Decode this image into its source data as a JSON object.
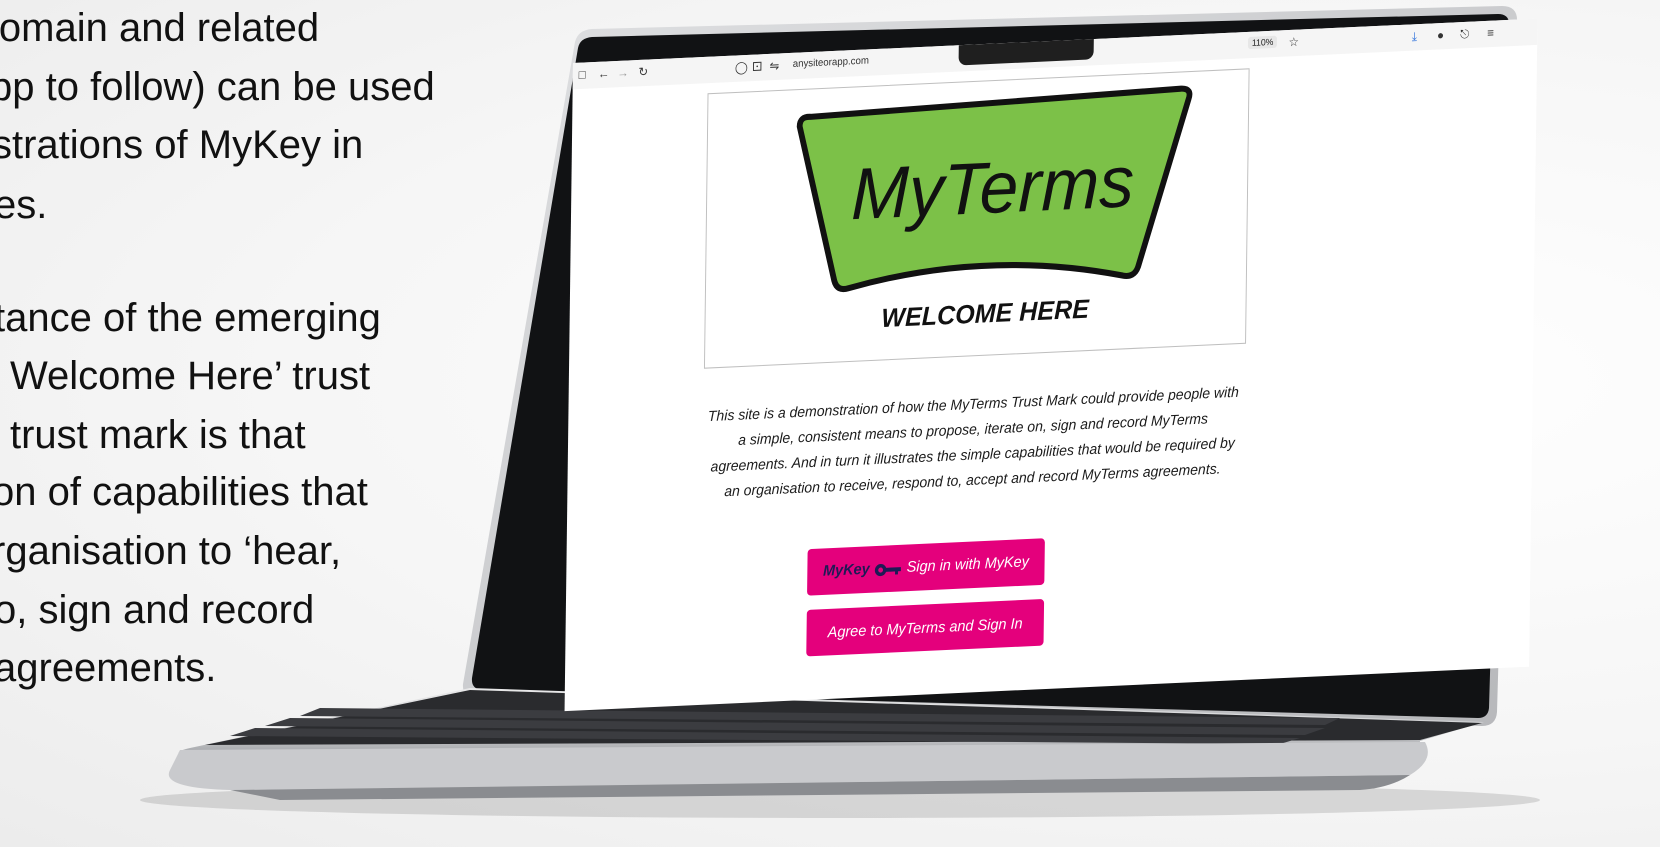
{
  "slide": {
    "lines": [
      "lomain and related",
      "pp to follow) can be used",
      "strations of MyKey in",
      "es.",
      "tance of the emerging",
      "Welcome Here’ trust",
      "trust mark is that",
      "on of capabilities that",
      "rganisation to ‘hear,",
      "o, sign and record",
      "agreements."
    ]
  },
  "browser": {
    "url": "anysiteorapp.com",
    "zoom": "110%",
    "icons": {
      "sidebar": "sidebar-icon",
      "back": "back-arrow-icon",
      "forward": "forward-arrow-icon",
      "reload": "reload-icon",
      "shield": "shield-icon",
      "lock": "lock-icon",
      "permissions": "permissions-icon",
      "star": "bookmark-star-icon",
      "download": "download-icon",
      "extension": "extension-icon",
      "menu": "menu-icon"
    }
  },
  "page": {
    "logo": {
      "wordmark": "MyTerms",
      "tagline": "WELCOME HERE",
      "green": "#7cc148",
      "outline": "#111111"
    },
    "description_lines": [
      "This site is a demonstration of how the MyTerms Trust Mark could provide people with",
      "a simple, consistent means to propose, iterate on, sign and record MyTerms",
      "agreements. And in turn it illustrates the simple capabilities that would be required by",
      "an organisation to receive, respond to, accept and record MyTerms agreements."
    ],
    "buttons": {
      "mykey_brand": "MyKey",
      "mykey_label": "Sign in with MyKey",
      "agree_label": "Agree to MyTerms and Sign In",
      "color": "#e4007c"
    }
  }
}
